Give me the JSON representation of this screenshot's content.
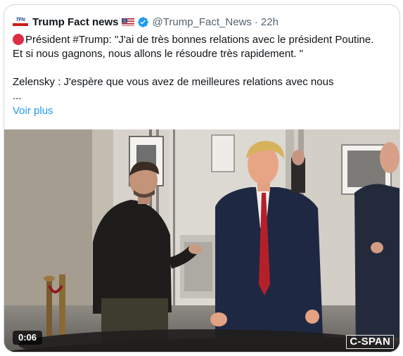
{
  "tweet": {
    "display_name": "Trump Fact news",
    "handle": "@Trump_Fact_News",
    "separator": "·",
    "timestamp": "22h",
    "avatar_text": "TFN",
    "text_lines": [
      "Président  #Trump: \"J'ai de très bonnes relations avec le président Poutine.",
      "Et si nous gagnons, nous allons le résoudre très rapidement. \"",
      "",
      "Zelensky : J'espère que vous avez de meilleures relations avec nous",
      "..."
    ],
    "show_more": "Voir plus"
  },
  "video": {
    "duration": "0:06",
    "watermark": "C-SPAN"
  },
  "colors": {
    "link": "#1d9bf0",
    "secondary_text": "#536471",
    "verified": "#1d9bf0",
    "emoji_red_circle": "#dd2e44",
    "border": "#cfd9de"
  },
  "icons": {
    "flag": "us-flag-icon",
    "verified": "verified-badge-icon",
    "red_circle": "red-circle-icon"
  }
}
